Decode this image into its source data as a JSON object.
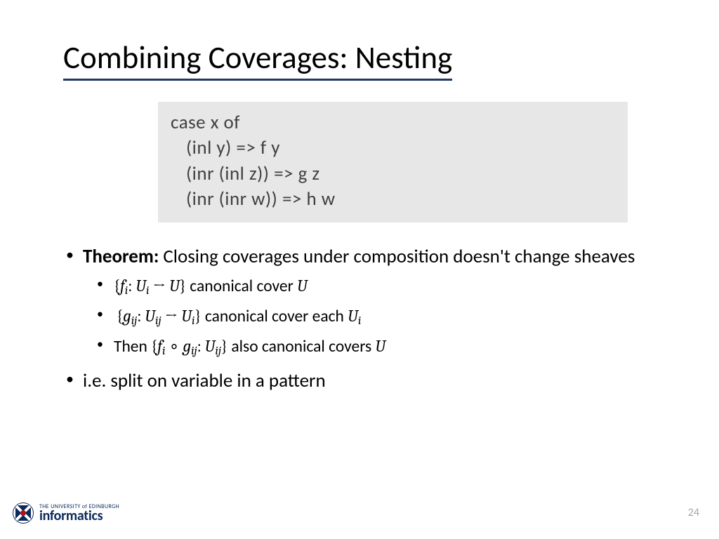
{
  "title": "Combining Coverages: Nesting",
  "code": {
    "l1": "case x of",
    "l2": "(inl y) => f y",
    "l3": "(inr (inl z)) => g z",
    "l4": "(inr (inr w)) => h w"
  },
  "bullets": {
    "theorem_label": "Theorem:",
    "theorem_text": " Closing coverages under composition doesn't change sheaves",
    "sub1_pre": "{",
    "sub1_f": "f",
    "sub1_i1": "i",
    "sub1_colon": ": ",
    "sub1_U1": "U",
    "sub1_i2": "i",
    "sub1_arr": " → ",
    "sub1_U2": "U",
    "sub1_close": "}",
    "sub1_tail": " canonical cover ",
    "sub1_Uend": "U",
    "sub2_pre": "{",
    "sub2_g": "g",
    "sub2_ij1": "ij",
    "sub2_colon": ": ",
    "sub2_U1": "U",
    "sub2_ij2": "ij",
    "sub2_arr": " → ",
    "sub2_U2": "U",
    "sub2_i": "i",
    "sub2_close": "}",
    "sub2_tail": " canonical cover each ",
    "sub2_Uend": "U",
    "sub2_iend": "i",
    "sub3_then": "Then ",
    "sub3_pre": "{",
    "sub3_f": "f",
    "sub3_i": "i",
    "sub3_comp": " ∘ ",
    "sub3_g": "g",
    "sub3_ij1": "ij",
    "sub3_colon": ": ",
    "sub3_U": "U",
    "sub3_ij2": "ij",
    "sub3_close": "}",
    "sub3_tail": " also canonical covers ",
    "sub3_Uend": "U",
    "last": "i.e. split on variable in a pattern"
  },
  "footer": {
    "page": "24",
    "uni_small": "THE UNIVERSITY of EDINBURGH",
    "uni_big": "informatics"
  }
}
